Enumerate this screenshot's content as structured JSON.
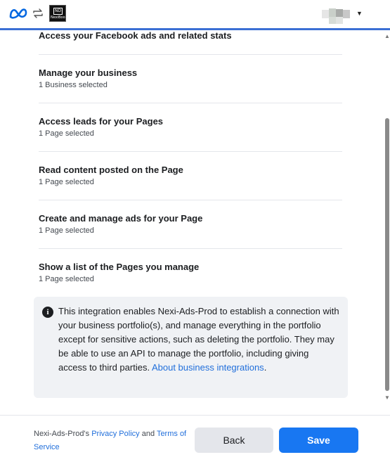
{
  "header": {
    "brand_icon": "meta-logo-icon",
    "connect_icon": "sync-icon",
    "app_logo_text": "NexiBook"
  },
  "permissions": [
    {
      "title": "Access your Facebook ads and related stats",
      "subtitle": ""
    },
    {
      "title": "Manage your business",
      "subtitle": "1 Business selected"
    },
    {
      "title": "Access leads for your Pages",
      "subtitle": "1 Page selected"
    },
    {
      "title": "Read content posted on the Page",
      "subtitle": "1 Page selected"
    },
    {
      "title": "Create and manage ads for your Page",
      "subtitle": "1 Page selected"
    },
    {
      "title": "Show a list of the Pages you manage",
      "subtitle": "1 Page selected"
    }
  ],
  "notice": {
    "icon": "info-icon",
    "text": "This integration enables Nexi-Ads-Prod to establish a connection with your business portfolio(s), and manage everything in the portfolio except for sensitive actions, such as deleting the portfolio. They may be able to use an API to manage the portfolio, including giving access to third parties.",
    "link": "About business integrations",
    "trailing": "."
  },
  "footer": {
    "legal_prefix": "Nexi-Ads-Prod's ",
    "privacy_link": "Privacy Policy",
    "and": " and ",
    "terms_link": "Terms of Service",
    "back_label": "Back",
    "save_label": "Save"
  },
  "colors": {
    "accent": "#1877f2",
    "link": "#216fdb",
    "header_line": "#3b6fd4"
  }
}
